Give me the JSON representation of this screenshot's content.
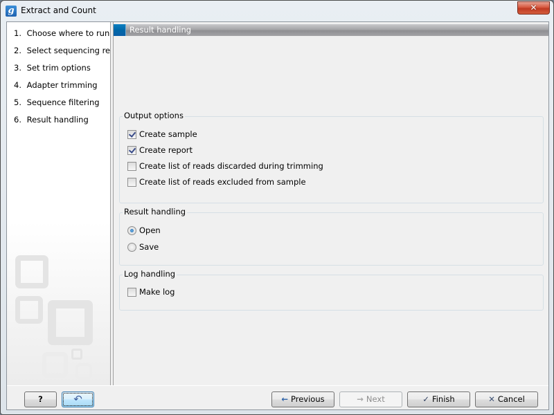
{
  "window": {
    "title": "Extract and Count",
    "app_icon_glyph": "g",
    "close_glyph": "✕"
  },
  "sidebar": {
    "steps": [
      {
        "num": "1.",
        "label": "Choose where to run"
      },
      {
        "num": "2.",
        "label": "Select sequencing reads"
      },
      {
        "num": "3.",
        "label": "Set trim options"
      },
      {
        "num": "4.",
        "label": "Adapter trimming"
      },
      {
        "num": "5.",
        "label": "Sequence filtering"
      },
      {
        "num": "6.",
        "label": "Result handling"
      }
    ]
  },
  "main": {
    "header": "Result handling",
    "output_options": {
      "label": "Output options",
      "items": [
        {
          "label": "Create sample",
          "checked": true
        },
        {
          "label": "Create report",
          "checked": true
        },
        {
          "label": "Create list of reads discarded during trimming",
          "checked": false
        },
        {
          "label": "Create list of reads excluded from sample",
          "checked": false
        }
      ]
    },
    "result_handling": {
      "label": "Result handling",
      "options": [
        {
          "label": "Open",
          "selected": true
        },
        {
          "label": "Save",
          "selected": false
        }
      ]
    },
    "log_handling": {
      "label": "Log handling",
      "items": [
        {
          "label": "Make log",
          "checked": false
        }
      ]
    }
  },
  "footer": {
    "help_glyph": "?",
    "reset_glyph": "↶",
    "previous": {
      "label": "Previous",
      "icon": "←"
    },
    "next": {
      "label": "Next",
      "icon": "→"
    },
    "finish": {
      "label": "Finish",
      "icon": "✓"
    },
    "cancel": {
      "label": "Cancel",
      "icon": "✕"
    }
  }
}
